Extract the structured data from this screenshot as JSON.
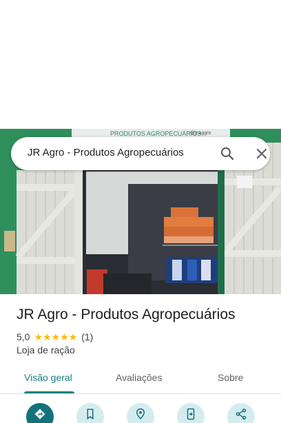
{
  "search": {
    "query": "JR Agro - Produtos Agropecuários"
  },
  "photo": {
    "sign_text": "PRODUTOS AGROPECUÁRIOS",
    "handle_text": "@jr.aggro"
  },
  "place": {
    "title": "JR Agro - Produtos Agropecuários",
    "rating": "5,0",
    "stars": "★★★★★",
    "review_count": "(1)",
    "category": "Loja de ração"
  },
  "tabs": [
    {
      "label": "Visão geral",
      "active": true
    },
    {
      "label": "Avaliações",
      "active": false
    },
    {
      "label": "Sobre",
      "active": false
    }
  ],
  "actions": [
    {
      "icon": "directions-icon"
    },
    {
      "icon": "bookmark-icon"
    },
    {
      "icon": "nearby-icon"
    },
    {
      "icon": "send-to-phone-icon"
    },
    {
      "icon": "share-icon"
    }
  ],
  "colors": {
    "accent": "#1a7f85",
    "star": "#fbbc04",
    "action_bg": "#d4ecf0",
    "action_primary": "#12727a"
  }
}
